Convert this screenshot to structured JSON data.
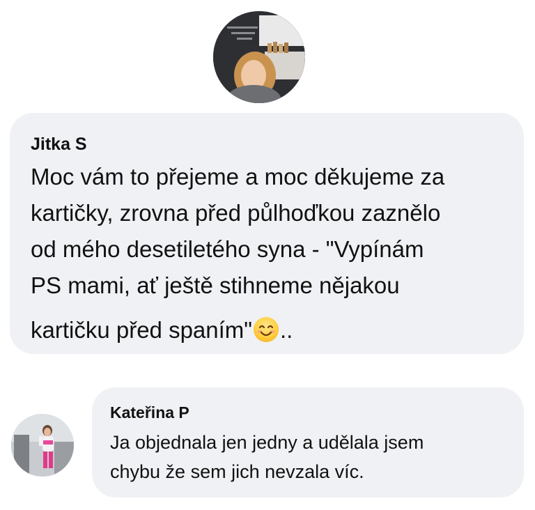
{
  "comments": [
    {
      "author": "Jitka S",
      "lines": [
        "Moc vám to přejeme a moc děkujeme za",
        "kartičky, zrovna před půlhoďkou zaznělo",
        "od mého desetiletého syna - \"Vypínám",
        "PS mami, ať ještě stihneme nějakou",
        "kartičku před spaním\"",
        ".."
      ],
      "emoji": "smiling-face-with-smiling-eyes"
    },
    {
      "author": "Kateřina P",
      "lines": [
        "Ja objednala jen jedny a udělala jsem",
        "chybu že sem jich nevzala víc."
      ]
    }
  ]
}
